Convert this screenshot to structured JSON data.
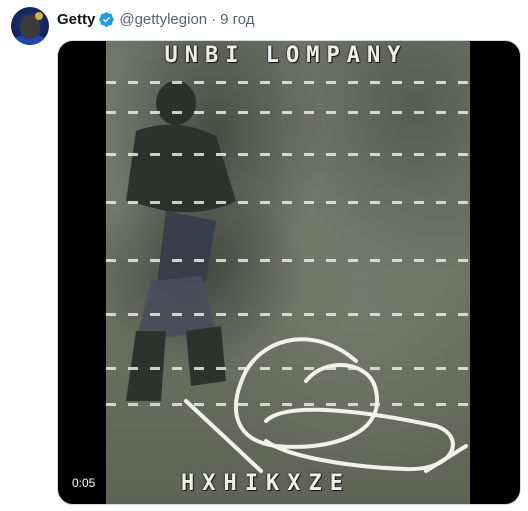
{
  "tweet": {
    "author_name": "Getty",
    "handle": "@gettylegion",
    "separator": "·",
    "time": "9 год"
  },
  "icons": {
    "verified": "verified-badge-icon",
    "avatar": "profile-avatar"
  },
  "colors": {
    "verified_blue": "#1d9bf0",
    "secondary_text": "#536471"
  },
  "video": {
    "overlay_top": "UNBI LOMPANY",
    "overlay_bottom": "HXHIKXZE",
    "duration": "0:05"
  }
}
